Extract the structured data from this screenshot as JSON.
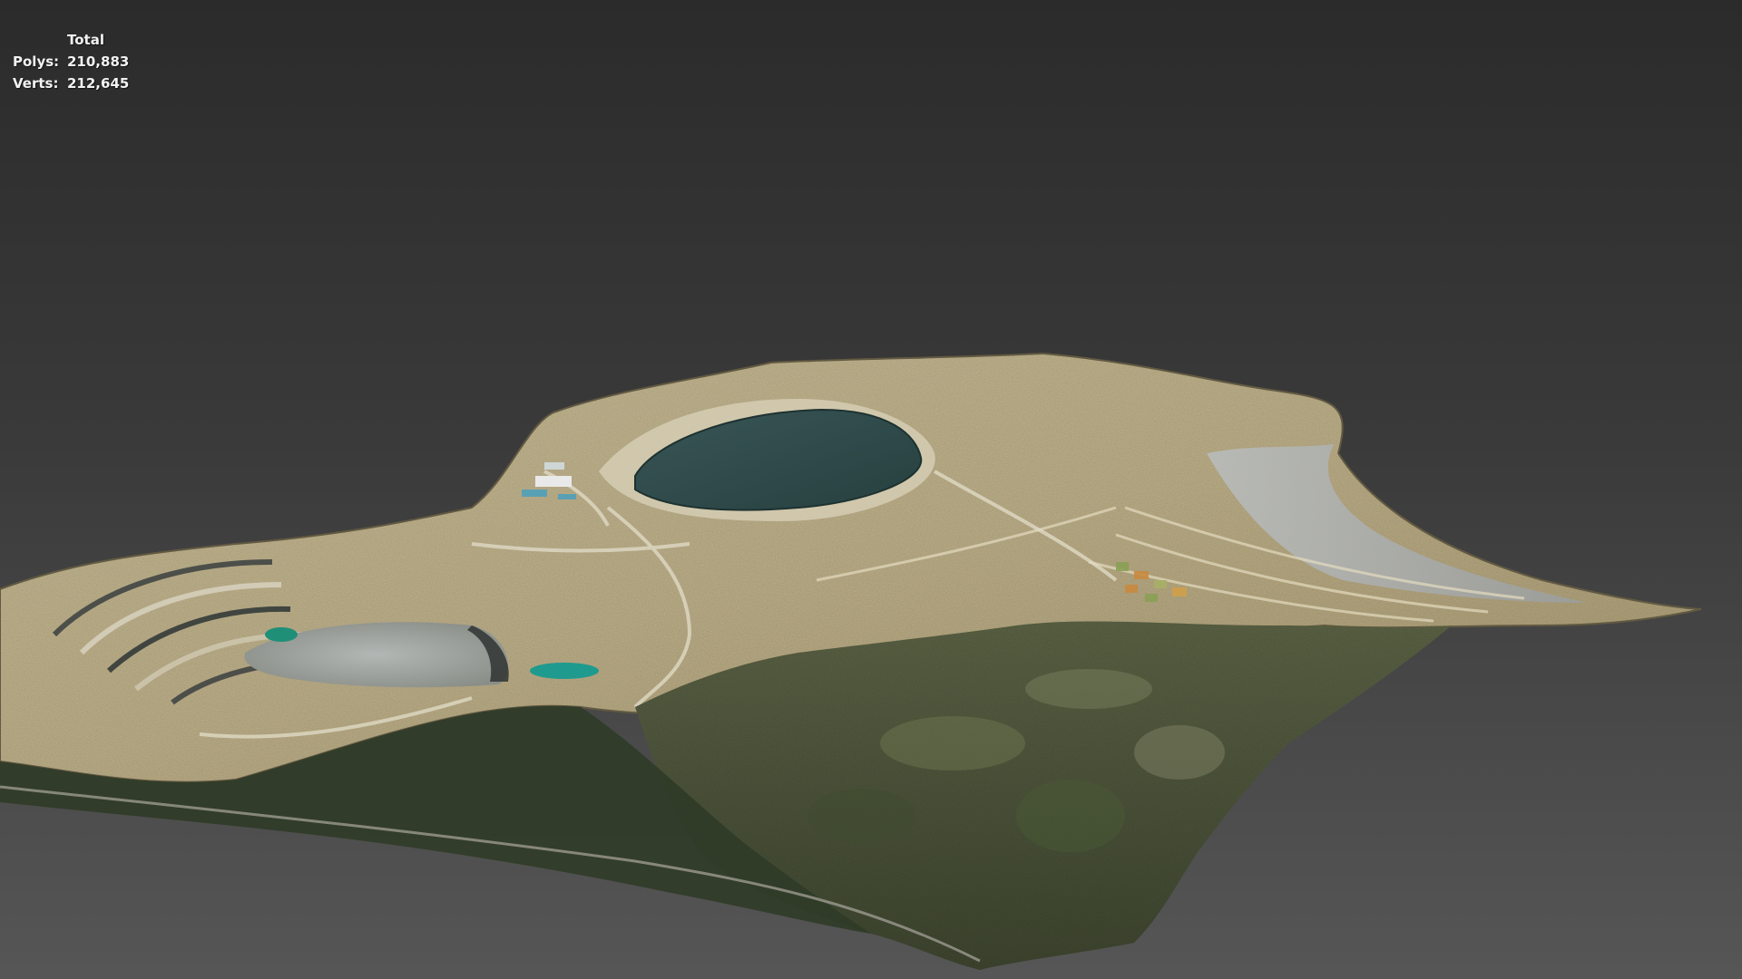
{
  "viewport": {
    "background_top": "#2b2b2b",
    "background_bottom": "#565656"
  },
  "stats": {
    "header": "Total",
    "polys_label": "Polys:",
    "polys_value": "210,883",
    "verts_label": "Verts:",
    "verts_value": "212,645"
  },
  "model": {
    "subject": "open-pit-mine-terrain-mesh",
    "colors": {
      "pit_lake": "#2f4a4c",
      "small_pond": "#1f8f86",
      "benches_light": "#cfc3a2",
      "benches_tan": "#b8a57a",
      "forest": "#55603f",
      "forest_dark": "#2f3a26",
      "tailings_gray": "#a8abab"
    }
  }
}
